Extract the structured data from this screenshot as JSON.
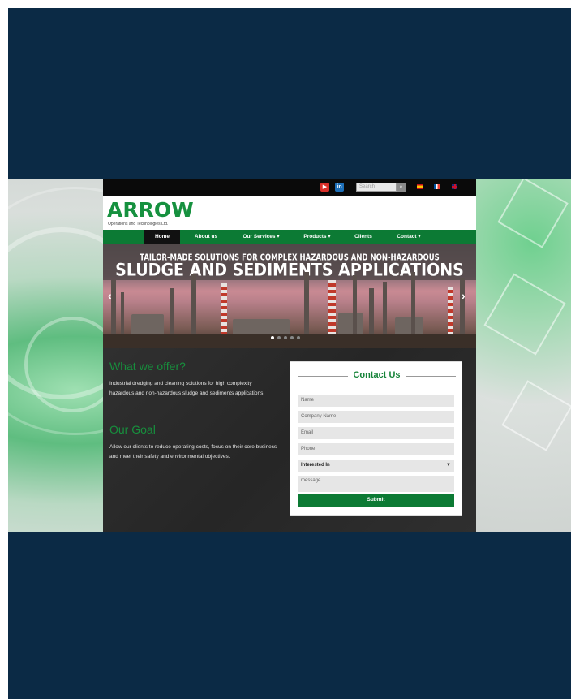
{
  "colors": {
    "navy_frame": "#0b2a45",
    "brand_green": "#16913f",
    "nav_green": "#0c7a34",
    "dark_panel": "#2c2c2c"
  },
  "topbar": {
    "icons": [
      "youtube-icon",
      "linkedin-icon"
    ],
    "search_placeholder": "Search",
    "search_icon": "search-icon",
    "flags": [
      "spanish-flag-icon",
      "french-flag-icon",
      "uk-flag-icon"
    ]
  },
  "header": {
    "logo": "ARROW",
    "logo_sub": "Operations and Technologies Ltd."
  },
  "nav": {
    "items": [
      "Home",
      "About us",
      "Our Services ▾",
      "Products ▾",
      "Clients",
      "Contact ▾"
    ],
    "active": "Home"
  },
  "hero": {
    "line1": "TAILOR-MADE SOLUTIONS FOR COMPLEX HAZARDOUS AND NON-HAZARDOUS",
    "line2": "SLUDGE AND SEDIMENTS APPLICATIONS",
    "prev": "‹",
    "next": "›"
  },
  "what": {
    "heading": "What we offer?",
    "text": "Industrial dredging and cleaning solutions for high complexity hazardous and non-hazardous sludge and sediments applications."
  },
  "goal": {
    "heading": "Our Goal",
    "text": "Allow our clients to reduce operating costs, focus on their core business and meet their safety and environmental objectives."
  },
  "contact": {
    "title": "Contact Us",
    "name": "Name",
    "company": "Company Name",
    "email": "Email",
    "phone": "Phone",
    "interested": "Interested In",
    "message": "message",
    "submit": "Submit"
  }
}
